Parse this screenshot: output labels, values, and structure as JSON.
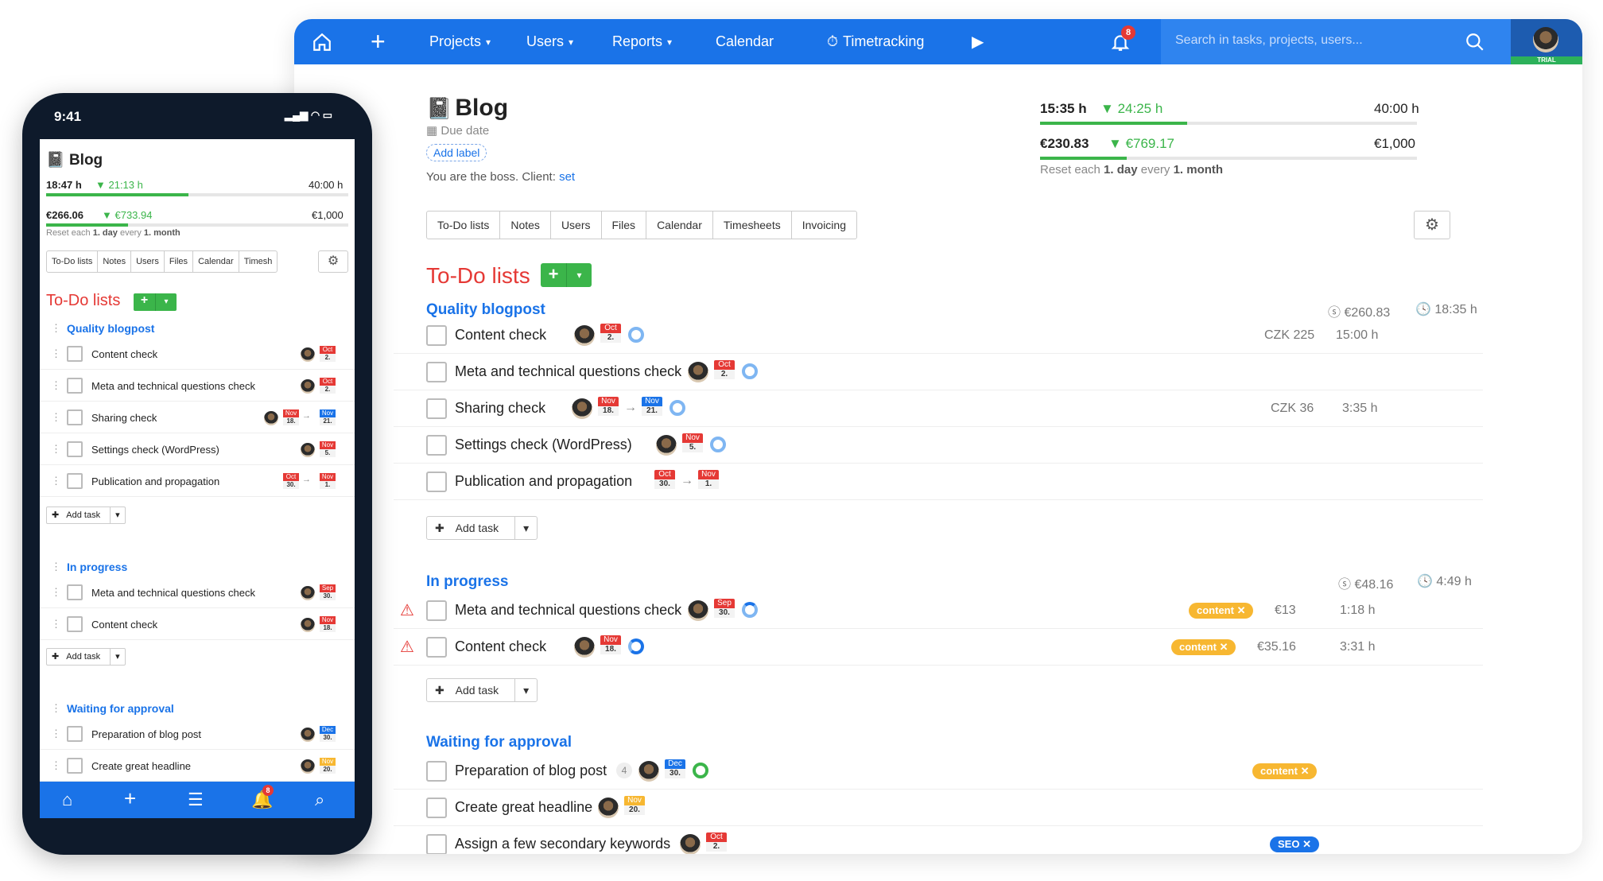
{
  "nav": {
    "items": [
      "Projects",
      "Users",
      "Reports",
      "Calendar",
      "Timetracking"
    ],
    "notif_count": "8",
    "search_placeholder": "Search in tasks, projects, users...",
    "trial": "TRIAL"
  },
  "project": {
    "title": "Blog",
    "due": "Due date",
    "add_label": "Add label",
    "boss_text": "You are the boss. Client: ",
    "client_link": "set",
    "time_spent": "15:35 h",
    "time_remaining": "24:25 h",
    "time_budget": "40:00 h",
    "time_progress": 0.39,
    "money_spent": "€230.83",
    "money_remaining": "€769.17",
    "money_budget": "€1,000",
    "money_progress": 0.23,
    "reset_prefix": "Reset each ",
    "reset_day": "1. day",
    "reset_every": " every ",
    "reset_month": "1. month"
  },
  "tabs": [
    "To-Do lists",
    "Notes",
    "Users",
    "Files",
    "Calendar",
    "Timesheets",
    "Invoicing"
  ],
  "todo_heading": "To-Do lists",
  "add_task": "Add task",
  "lists": [
    {
      "name": "Quality blogpost",
      "money": "€260.83",
      "hours": "18:35 h",
      "tasks": [
        {
          "name": "Content check",
          "due": {
            "m": "Oct",
            "d": "2."
          },
          "rval1": "CZK 225",
          "rval2": "15:00 h"
        },
        {
          "name": "Meta and technical questions check",
          "due": {
            "m": "Oct",
            "d": "2."
          }
        },
        {
          "name": "Sharing check",
          "start": {
            "m": "Nov",
            "d": "18."
          },
          "due": {
            "m": "Nov",
            "d": "21."
          },
          "rval1": "CZK 36",
          "rval2": "3:35 h"
        },
        {
          "name": "Settings check (WordPress)",
          "due": {
            "m": "Nov",
            "d": "5."
          }
        },
        {
          "name": "Publication and propagation",
          "start": {
            "m": "Oct",
            "d": "30."
          },
          "due": {
            "m": "Nov",
            "d": "1."
          }
        }
      ]
    },
    {
      "name": "In progress",
      "money": "€48.16",
      "hours": "4:49 h",
      "tasks": [
        {
          "name": "Meta and technical questions check",
          "due": {
            "m": "Sep",
            "d": "30."
          },
          "tag": "content",
          "rval1": "€13",
          "rval2": "1:18 h"
        },
        {
          "name": "Content check",
          "due": {
            "m": "Nov",
            "d": "18."
          },
          "tag": "content",
          "rval1": "€35.16",
          "rval2": "3:31 h"
        }
      ]
    },
    {
      "name": "Waiting for approval",
      "tasks": [
        {
          "name": "Preparation of blog post",
          "count": "4",
          "due": {
            "m": "Dec",
            "d": "30."
          },
          "tag": "content"
        },
        {
          "name": "Create great headline",
          "due": {
            "m": "Nov",
            "d": "20."
          }
        },
        {
          "name": "Assign a few secondary keywords",
          "due": {
            "m": "Oct",
            "d": "2."
          },
          "tag": "SEO"
        }
      ]
    }
  ],
  "phone": {
    "time": "9:41",
    "time_spent": "18:47 h",
    "time_remaining": "21:13 h",
    "time_budget": "40:00 h",
    "time_progress": 0.47,
    "money_spent": "€266.06",
    "money_remaining": "€733.94",
    "money_budget": "€1,000",
    "money_progress": 0.27,
    "tabs": [
      "To-Do lists",
      "Notes",
      "Users",
      "Files",
      "Calendar",
      "Timesh"
    ],
    "notif_count": "8"
  },
  "colors": {
    "brand": "#1a73e8",
    "accent_red": "#e53935",
    "green": "#3bb54a",
    "tag_orange": "#f7b731",
    "tag_blue": "#1a73e8"
  }
}
